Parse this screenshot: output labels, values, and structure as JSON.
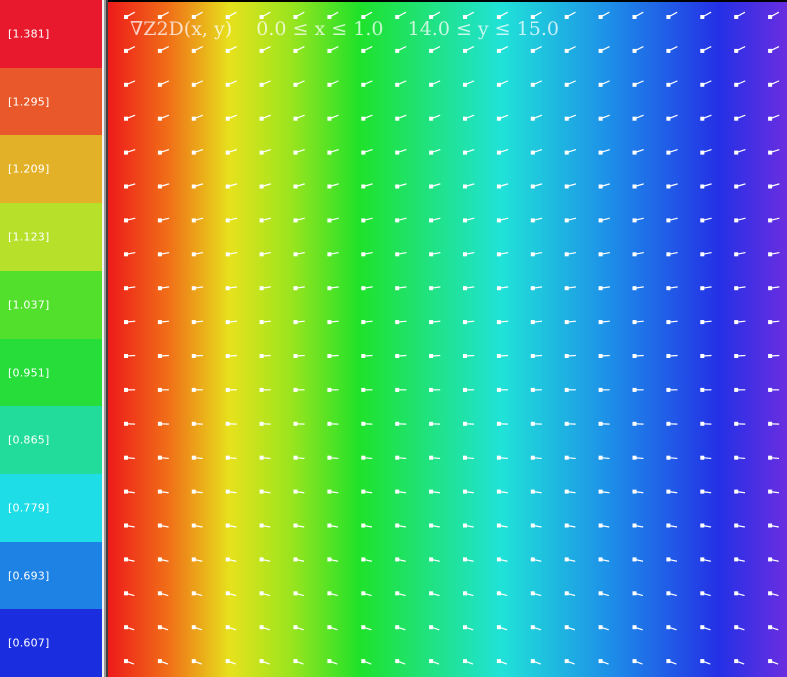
{
  "chart_data": {
    "type": "heatmap",
    "title": "∇Z2D(x, y)    0.0 ≤ x ≤ 1.0    14.0 ≤ y ≤ 15.0",
    "xlim": [
      0.0,
      1.0
    ],
    "ylim": [
      14.0,
      15.0
    ],
    "legend_placement": "left",
    "legend": {
      "levels": [
        "[1.381]",
        "[1.295]",
        "[1.209]",
        "[1.123]",
        "[1.037]",
        "[0.951]",
        "[0.865]",
        "[0.779]",
        "[0.693]",
        "[0.607]"
      ],
      "values": [
        1.381,
        1.295,
        1.209,
        1.123,
        1.037,
        0.951,
        0.865,
        0.779,
        0.693,
        0.607
      ],
      "colors": [
        "#e8192c",
        "#e8582a",
        "#e3b128",
        "#b6e02a",
        "#53e02c",
        "#27dd3a",
        "#21dc9a",
        "#1fdde6",
        "#1d82e3",
        "#1a2ee0"
      ]
    },
    "field_colors": [
      "#ee1a1a",
      "#f07018",
      "#e6e21c",
      "#9ae41e",
      "#1fe22a",
      "#20e2d8",
      "#1d8ee8",
      "#2430e6",
      "#6a2ee0"
    ],
    "grid": false,
    "vector_glyphs": "white arrows",
    "vector_grid": {
      "columns": 20,
      "rows": 20
    }
  }
}
